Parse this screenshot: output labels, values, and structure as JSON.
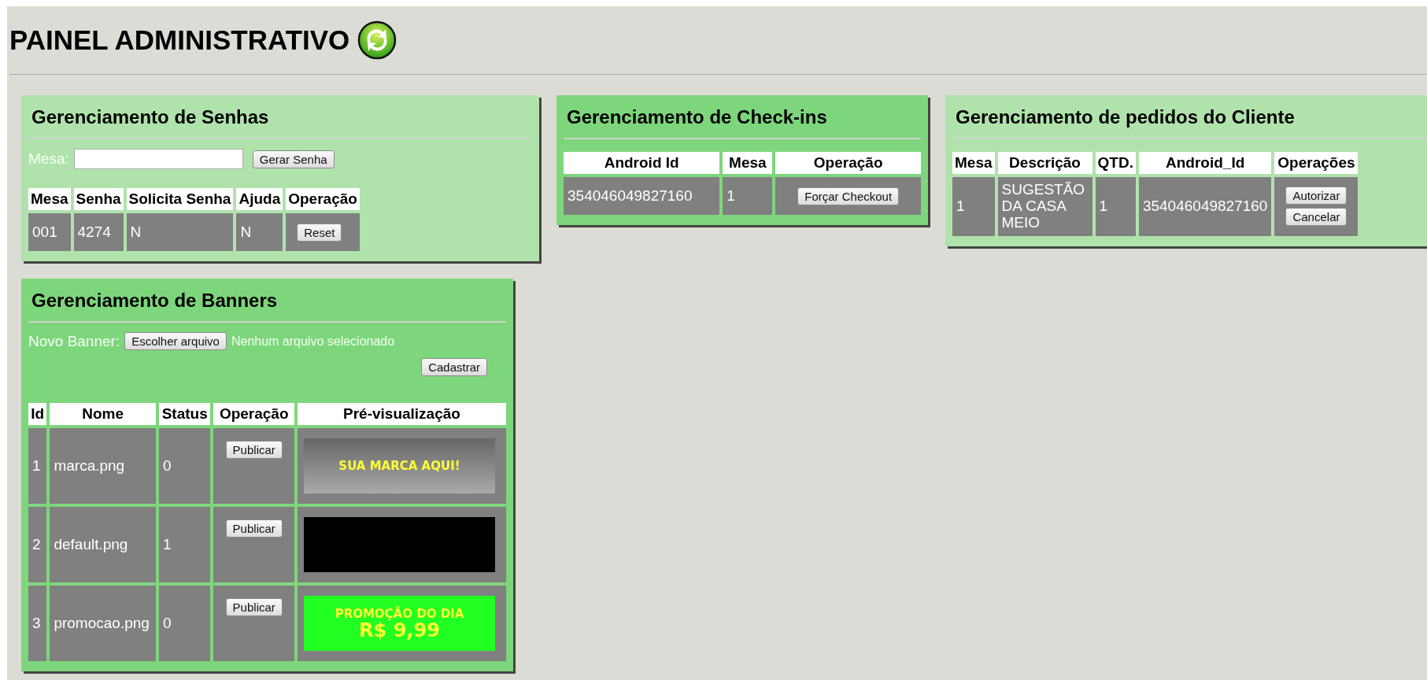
{
  "title": "PAINEL ADMINISTRATIVO",
  "senhas": {
    "title": "Gerenciamento de Senhas",
    "mesa_label": "Mesa:",
    "button": "Gerar Senha",
    "columns": [
      "Mesa",
      "Senha",
      "Solicita Senha",
      "Ajuda",
      "Operação"
    ],
    "rows": [
      {
        "cells": [
          "001",
          "4274",
          "N",
          "N"
        ],
        "button": "Reset"
      }
    ]
  },
  "checkins": {
    "title": "Gerenciamento de Check-ins",
    "columns": [
      "Android Id",
      "Mesa",
      "Operação"
    ],
    "rows": [
      {
        "cells": [
          "354046049827160",
          "1"
        ],
        "button": "Forçar Checkout"
      }
    ]
  },
  "pedidos": {
    "title": "Gerenciamento de pedidos do Cliente",
    "columns": [
      "Mesa",
      "Descrição",
      "QTD.",
      "Android_Id",
      "Operações"
    ],
    "rows": [
      {
        "cells": [
          "1",
          "SUGESTÃO DA CASA MEIO",
          "1",
          "354046049827160"
        ],
        "buttons": [
          "Autorizar",
          "Cancelar"
        ]
      }
    ]
  },
  "banners": {
    "title": "Gerenciamento de Banners",
    "novo_label": "Novo Banner:",
    "file_button": "Escolher arquivo",
    "file_status": "Nenhum arquivo selecionado",
    "submit": "Cadastrar",
    "columns": [
      "Id",
      "Nome",
      "Status",
      "Operação",
      "Pré-visualização"
    ],
    "rows": [
      {
        "id": "1",
        "nome": "marca.png",
        "status": "0",
        "button": "Publicar",
        "preview": {
          "kind": "gray",
          "lines": [
            "SUA MARCA AQUI!"
          ]
        }
      },
      {
        "id": "2",
        "nome": "default.png",
        "status": "1",
        "button": "Publicar",
        "preview": {
          "kind": "black"
        }
      },
      {
        "id": "3",
        "nome": "promocao.png",
        "status": "0",
        "button": "Publicar",
        "preview": {
          "kind": "green",
          "lines": [
            "PROMOÇÃO DO DIA",
            "R$ 9,99"
          ]
        }
      }
    ]
  }
}
